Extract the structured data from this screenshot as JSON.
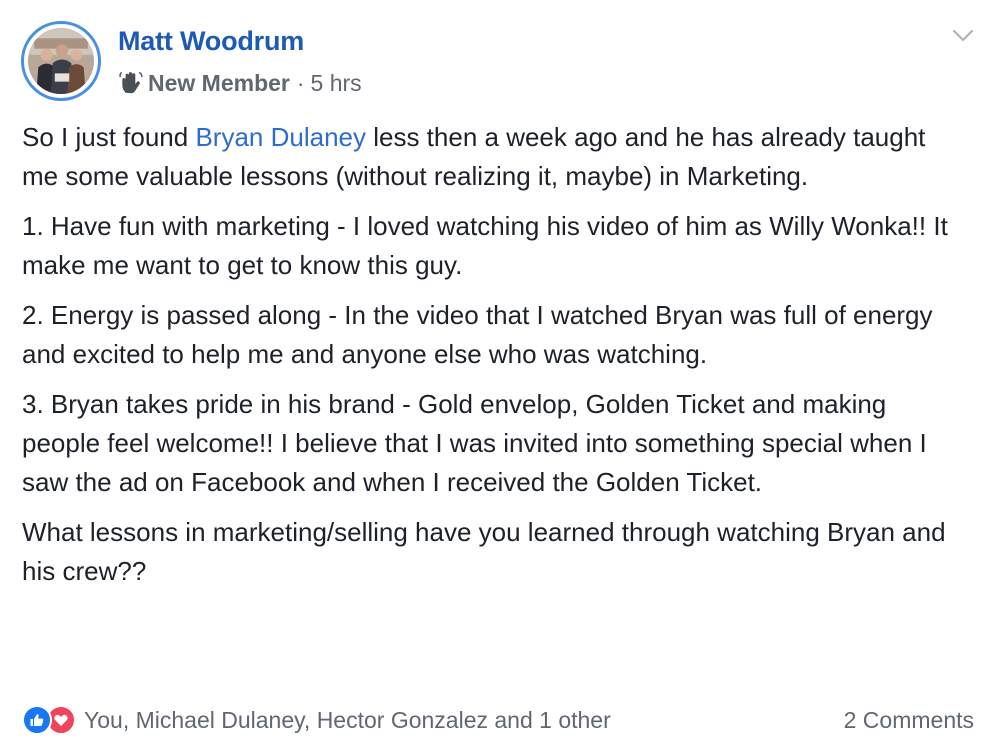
{
  "author": {
    "name": "Matt Woodrum",
    "badge": "New Member",
    "separator": "·",
    "time": "5 hrs"
  },
  "post": {
    "p1_before": "So I just found ",
    "p1_mention": "Bryan Dulaney",
    "p1_after": " less then a week ago and he has already taught me some valuable lessons (without realizing it, maybe) in Marketing.",
    "p2": "1. Have fun with marketing - I loved watching his video of him as Willy Wonka!! It make me want to get to know this guy.",
    "p3": "2. Energy is passed along - In the video that I watched Bryan was full of energy and excited to help me and anyone else who was watching.",
    "p4": "3. Bryan takes pride in his brand - Gold envelop, Golden Ticket and making people feel welcome!! I believe that I was invited into something special when I saw the ad on Facebook and when I received the Golden Ticket.",
    "p5": "What lessons in marketing/selling have you learned through watching Bryan and his crew??"
  },
  "footer": {
    "reactions_text": "You, Michael Dulaney, Hector Gonzalez and 1 other",
    "comments": "2 Comments"
  },
  "icons": {
    "like": "like-icon",
    "love": "love-icon",
    "badge": "wave-icon",
    "menu": "chevron-down-icon"
  },
  "colors": {
    "name": "#1c5ab5",
    "mention": "#2e6bd1",
    "meta": "#606770",
    "like": "#1877f2",
    "love": "#f0445d",
    "avatar_ring": "#4a90e2"
  }
}
